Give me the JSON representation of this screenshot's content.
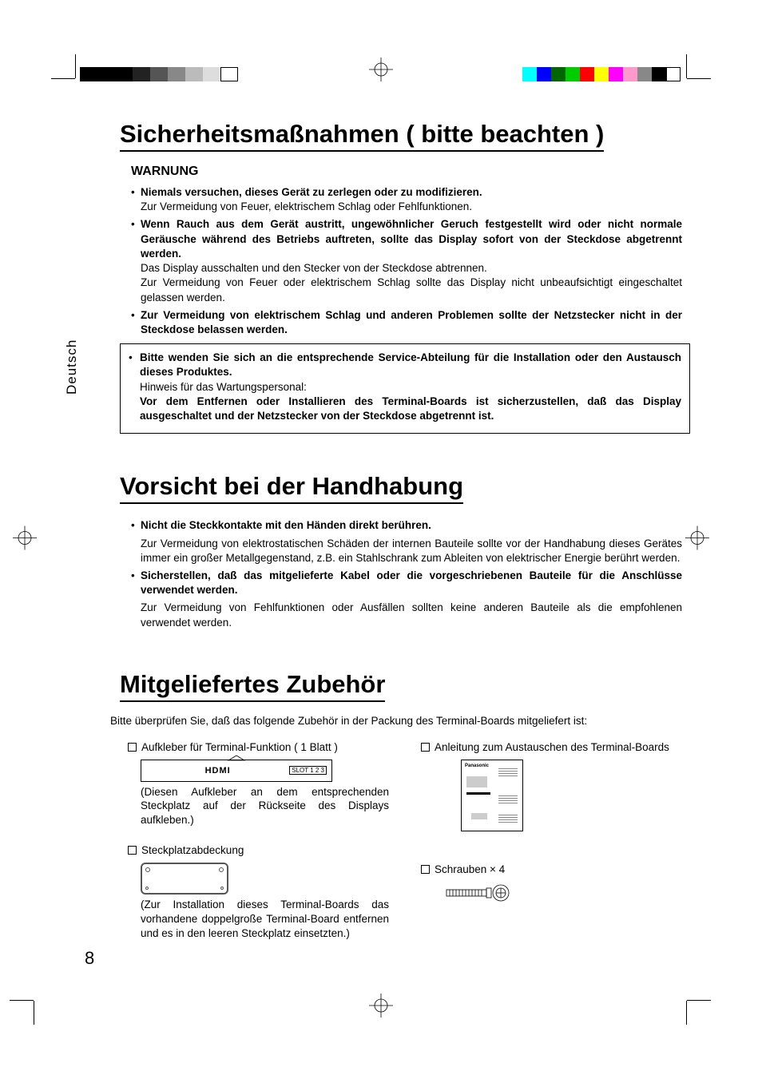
{
  "language_tab": "Deutsch",
  "page_number": "8",
  "section1": {
    "title": "Sicherheitsmaßnahmen ( bitte beachten )",
    "subhead": "WARNUNG",
    "bullets": [
      {
        "bold": "Niemals versuchen, dieses Gerät zu zerlegen oder zu modifizieren.",
        "plain": "Zur Vermeidung von Feuer, elektrischem Schlag oder Fehlfunktionen."
      },
      {
        "bold": "Wenn Rauch aus dem Gerät austritt, ungewöhnlicher Geruch festgestellt wird oder nicht normale Geräusche während des Betriebs auftreten, sollte das Display sofort von der Steckdose abgetrennt werden.",
        "plain": "Das Display ausschalten und den Stecker von der Steckdose abtrennen.\nZur Vermeidung von Feuer oder elektrischem Schlag sollte das Display nicht unbeaufsichtigt eingeschaltet gelassen werden."
      },
      {
        "bold": "Zur Vermeidung von elektrischem Schlag und anderen Problemen sollte der Netzstecker nicht in der Steckdose belassen werden.",
        "plain": ""
      }
    ],
    "box": {
      "bold1": "Bitte wenden Sie sich an die entsprechende Service-Abteilung für die Installation oder den Austausch dieses Produktes.",
      "plain1": "Hinweis für das Wartungspersonal:",
      "bold2": "Vor dem Entfernen oder Installieren des Terminal-Boards ist sicherzustellen, daß das Display ausgeschaltet und der Netzstecker von der Steckdose abgetrennt ist."
    }
  },
  "section2": {
    "title": "Vorsicht bei der Handhabung",
    "bullets": [
      {
        "bold": "Nicht die Steckkontakte mit den Händen direkt berühren.",
        "plain": "Zur Vermeidung von elektrostatischen Schäden der internen Bauteile sollte vor der Handhabung dieses Gerätes immer ein großer Metallgegenstand, z.B. ein Stahlschrank zum Ableiten von elektrischer Energie berührt werden."
      },
      {
        "bold": "Sicherstellen, daß das mitgelieferte Kabel oder die vorgeschriebenen Bauteile für die Anschlüsse verwendet werden.",
        "plain": "Zur Vermeidung von Fehlfunktionen oder Ausfällen sollten keine anderen Bauteile als die empfohlenen verwendet werden."
      }
    ]
  },
  "section3": {
    "title": "Mitgeliefertes Zubehör",
    "intro": "Bitte überprüfen Sie, daß das folgende Zubehör in der Packung des Terminal-Boards mitgeliefert ist:",
    "items": {
      "sticker": {
        "title": "Aufkleber für Terminal-Funktion ( 1 Blatt )",
        "hdmi": "HDMI",
        "slot": "SLOT 1 2 3",
        "note": "(Diesen Aufkleber an dem entsprechenden Steckplatz auf der Rückseite des Displays aufkleben.)"
      },
      "slotcover": {
        "title": "Steckplatzabdeckung",
        "note": "(Zur Installation dieses Terminal-Boards das vorhandene doppelgroße Terminal-Board entfernen und es in den leeren Steckplatz einsetzten.)"
      },
      "manual": {
        "title": "Anleitung zum Austauschen des Terminal-Boards",
        "brand": "Panasonic"
      },
      "screws": {
        "title": "Schrauben × 4"
      }
    }
  }
}
